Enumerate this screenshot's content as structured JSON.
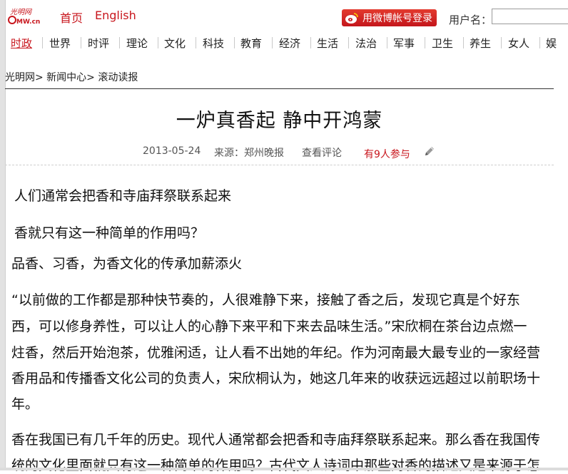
{
  "header": {
    "logo_text": "光明网 GMW.cn",
    "nav": [
      "首页",
      "English"
    ],
    "weibo_login": "用微博帐号登录",
    "username_label": "用户名："
  },
  "channels": [
    "时政",
    "世界",
    "时评",
    "理论",
    "文化",
    "科技",
    "教育",
    "经济",
    "生活",
    "法治",
    "军事",
    "卫生",
    "养生",
    "女人",
    "娱"
  ],
  "breadcrumb": "光明网> 新闻中心> 滚动读报",
  "article": {
    "title": "一炉真香起  静中开鸿蒙",
    "date": "2013-05-24",
    "source": "来源：郑州晚报",
    "comments_link": "查看评论",
    "participants": "有9人参与",
    "subtitles": [
      "人们通常会把香和寺庙拜祭联系起来",
      "香就只有这一种简单的作用吗？",
      "品香、习香，为香文化的传承加薪添火"
    ],
    "para1_lines": [
      "“以前做的工作都是那种快节奏的，人很难静下来，接触了香之后，发现它真是个好东",
      "西，可以修身养性，可以让人的心静下来平和下来去品味生活。”宋欣桐在茶台边点燃一",
      "炷香，然后开始泡茶，优雅闲适，让人看不出她的年纪。作为河南最大最专业的一家经营",
      "香用品和传播香文化公司的负责人，宋欣桐认为，她这几年来的收获远远超过以前职场十",
      "年。"
    ],
    "para2_lines": [
      "香在我国已有几千年的历史。现代人通常都会把香和寺庙拜祭联系起来。那么香在我国传",
      "统的文化里面就只有这一种简单的作用吗？古代文人诗词中那些对香的描述又是来源于怎"
    ]
  },
  "colors": {
    "accent": "#c8161d"
  }
}
